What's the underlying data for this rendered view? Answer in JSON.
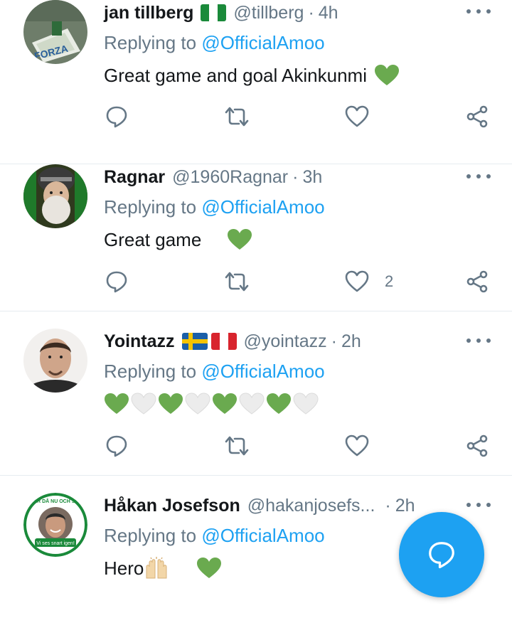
{
  "tweets": [
    {
      "name": "jan tillberg",
      "handle": "@tillberg",
      "time": "4h",
      "reply_prefix": "Replying to",
      "reply_to": "@OfficialAmoo",
      "text": "Great game and goal Akinkunmi",
      "like_count": "",
      "avatar_text": "FORZA"
    },
    {
      "name": "Ragnar",
      "handle": "@1960Ragnar",
      "time": "3h",
      "reply_prefix": "Replying to",
      "reply_to": "@OfficialAmoo",
      "text": "Great game",
      "like_count": "2"
    },
    {
      "name": "Yointazz",
      "handle": "@yointazz",
      "time": "2h",
      "reply_prefix": "Replying to",
      "reply_to": "@OfficialAmoo",
      "text": "",
      "like_count": ""
    },
    {
      "name": "Håkan Josefson",
      "handle": "@hakanjosefs...",
      "time": "2h",
      "reply_prefix": "Replying to",
      "reply_to": "@OfficialAmoo",
      "text": "Hero",
      "like_count": "",
      "avatar_text_top": "VI ÄR DÅ NU OCH SEN!",
      "avatar_text_bottom": "Vi ses snart igen!"
    }
  ],
  "icons": [
    "comment-icon",
    "retweet-icon",
    "like-icon",
    "share-icon",
    "more-icon",
    "compose-reply-icon"
  ],
  "colors": {
    "accent": "#1da1f2",
    "secondary_text": "#657786",
    "nigeria_green": "#1a8a3a",
    "heart_green": "#6aaa4f"
  }
}
